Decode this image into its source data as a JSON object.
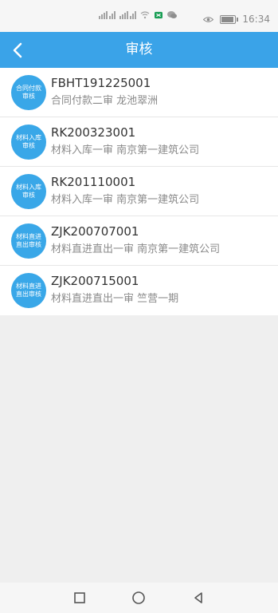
{
  "status_bar": {
    "time": "16:34",
    "battery_level": 0.8
  },
  "header": {
    "title": "审核",
    "back_icon": "chevron-left-icon"
  },
  "items": [
    {
      "avatar": "合同付款审核",
      "title": "FBHT191225001",
      "subtitle": "合同付款二审  龙池翠洲"
    },
    {
      "avatar": "材料入库审核",
      "title": "RK200323001",
      "subtitle": "材料入库一审  南京第一建筑公司"
    },
    {
      "avatar": "材料入库审核",
      "title": "RK201110001",
      "subtitle": "材料入库一审  南京第一建筑公司"
    },
    {
      "avatar": "材料直进直出审核",
      "title": "ZJK200707001",
      "subtitle": "材料直进直出一审  南京第一建筑公司"
    },
    {
      "avatar": "材料直进直出审核",
      "title": "ZJK200715001",
      "subtitle": "材料直进直出一审  竺营一期"
    }
  ],
  "navigation": {
    "buttons": [
      "recent-apps-icon",
      "home-icon",
      "back-icon"
    ]
  },
  "colors": {
    "header": "#3aa3e8",
    "avatar": "#39a7e8",
    "background": "#efefef"
  }
}
